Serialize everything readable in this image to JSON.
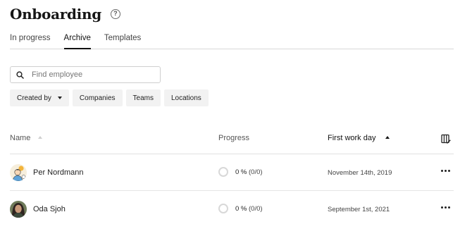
{
  "header": {
    "title": "Onboarding",
    "help_icon": "help-circle-icon"
  },
  "tabs": [
    {
      "label": "In progress",
      "active": false
    },
    {
      "label": "Archive",
      "active": true
    },
    {
      "label": "Templates",
      "active": false
    }
  ],
  "search": {
    "placeholder": "Find employee",
    "value": "",
    "icon": "search-icon"
  },
  "filters": [
    {
      "label": "Created by",
      "has_dropdown": true
    },
    {
      "label": "Companies",
      "has_dropdown": false
    },
    {
      "label": "Teams",
      "has_dropdown": false
    },
    {
      "label": "Locations",
      "has_dropdown": false
    }
  ],
  "table": {
    "columns": {
      "name": "Name",
      "progress": "Progress",
      "first_work_day": "First work day"
    },
    "sort": {
      "column": "first_work_day",
      "direction": "ascending"
    },
    "column_settings_icon": "column-settings-icon",
    "rows": [
      {
        "name": "Per Nordmann",
        "progress_pct": "0 %",
        "progress_count": "(0/0)",
        "first_work_day": "November 14th, 2019",
        "avatar": "illustrated-avatar"
      },
      {
        "name": "Oda Sjoh",
        "progress_pct": "0 %",
        "progress_count": "(0/0)",
        "first_work_day": "September 1st, 2021",
        "avatar": "photo-avatar"
      }
    ]
  }
}
